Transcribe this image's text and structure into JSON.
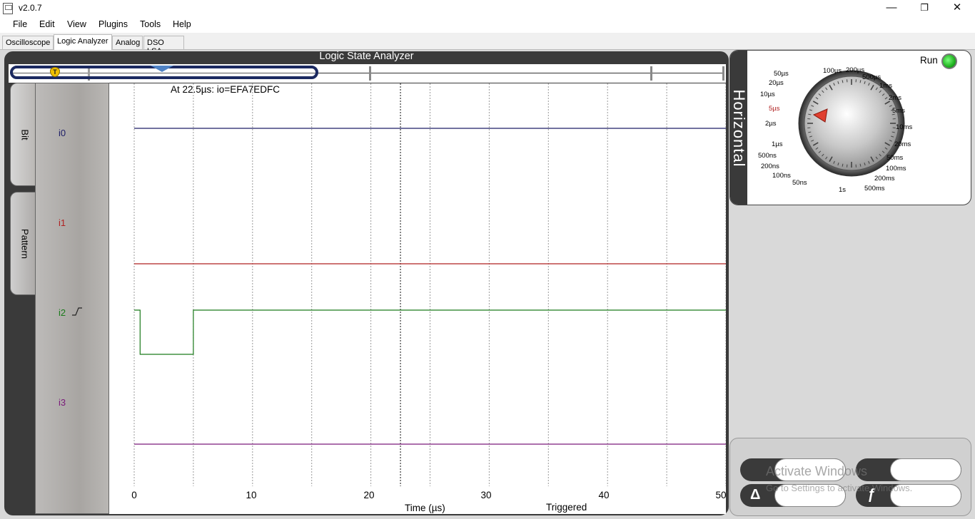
{
  "window": {
    "title": "v2.0.7",
    "minimize": "—",
    "restore": "❐",
    "close": "✕"
  },
  "menu": [
    "File",
    "Edit",
    "View",
    "Plugins",
    "Tools",
    "Help"
  ],
  "tabs": [
    {
      "label": "Oscilloscope",
      "active": false
    },
    {
      "label": "Logic Analyzer",
      "active": true
    },
    {
      "label": "Analog",
      "active": false
    },
    {
      "label": "DSO LSA",
      "active": false
    }
  ],
  "lsa": {
    "title": "Logic State Analyzer",
    "trigger_marker": "T",
    "side_tabs": [
      "Bit",
      "Pattern"
    ],
    "readout": "At 22.5µs:  io=EFA7EDFC",
    "channels": [
      {
        "name": "i0",
        "color": "#1c1c66"
      },
      {
        "name": "i1",
        "color": "#b02020"
      },
      {
        "name": "i2",
        "color": "#1a7a1a"
      },
      {
        "name": "i3",
        "color": "#7a1a7a"
      }
    ],
    "x_ticks": [
      "0",
      "10",
      "20",
      "30",
      "40",
      "50"
    ],
    "x_axis_label": "Time (µs)",
    "trigger_status": "Triggered",
    "cursor_time_us": 22.5
  },
  "chart_data": {
    "type": "line",
    "xlabel": "Time (µs)",
    "xlim": [
      0,
      50
    ],
    "series": [
      {
        "name": "i0",
        "x": [
          0,
          50
        ],
        "y": [
          0,
          0
        ]
      },
      {
        "name": "i1",
        "x": [
          0,
          50
        ],
        "y": [
          0,
          0
        ]
      },
      {
        "name": "i2",
        "x": [
          0,
          0.5,
          0.5,
          5,
          5,
          50
        ],
        "y": [
          1,
          1,
          0,
          0,
          1,
          1
        ]
      },
      {
        "name": "i3",
        "x": [
          0,
          50
        ],
        "y": [
          0,
          0
        ]
      }
    ],
    "grid": true
  },
  "horizontal": {
    "title": "Horizontal",
    "run_label": "Run",
    "dial_labels": [
      "100µs",
      "200µs",
      "500µs",
      "1ms",
      "2ms",
      "5ms",
      "10ms",
      "20ms",
      "50ms",
      "100ms",
      "200ms",
      "500ms",
      "1s",
      "50ns",
      "100ns",
      "200ns",
      "500ns",
      "1µs",
      "2µs",
      "5µs",
      "10µs",
      "20µs",
      "50µs"
    ],
    "selected": "5µs"
  },
  "watermark": {
    "title": "Activate Windows",
    "subtitle": "Go to Settings to activate Windows."
  },
  "colors": {
    "frame": "#3a3a3a",
    "overview_ellipse": "#1b2960",
    "led": "#1fb21f",
    "selected_dial": "#b02020"
  }
}
